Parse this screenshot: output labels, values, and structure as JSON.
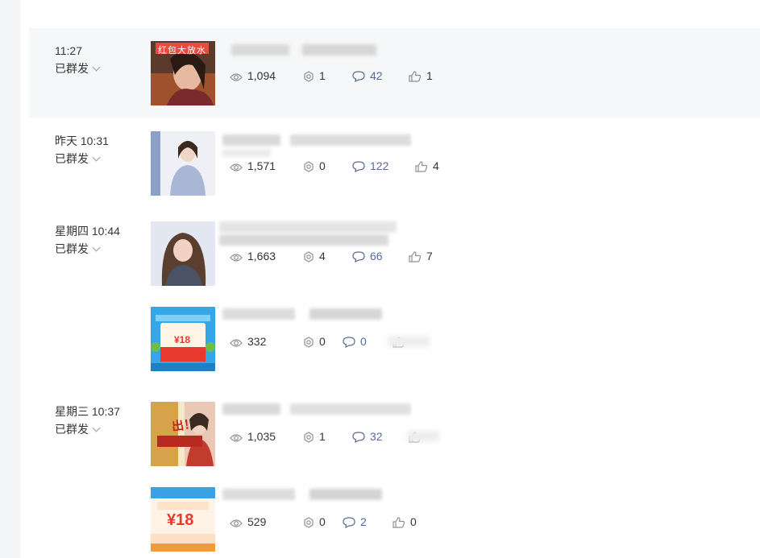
{
  "status_label": "已群发",
  "posts": [
    {
      "time": "11:27",
      "status": "已群发",
      "thumb_icon": "red-packet-woman-thumbnail",
      "thumb_text": "红包大放水",
      "stats": {
        "views": "1,094",
        "shares": "1",
        "comments": "42",
        "likes": "1"
      }
    },
    {
      "time": "昨天 10:31",
      "status": "已群发",
      "thumb_icon": "woman-portrait-thumbnail",
      "stats": {
        "views": "1,571",
        "shares": "0",
        "comments": "122",
        "likes": "4"
      }
    },
    {
      "time": "星期四 10:44",
      "status": "已群发",
      "thumb_icon": "woman-portrait-thumbnail",
      "stats": {
        "views": "1,663",
        "shares": "4",
        "comments": "66",
        "likes": "7"
      }
    },
    {
      "time": "",
      "status": "",
      "thumb_icon": "red-packet-coupon-thumbnail",
      "thumb_text": "¥18",
      "stats": {
        "views": "332",
        "shares": "0",
        "comments": "0",
        "likes": ""
      }
    },
    {
      "time": "星期三 10:37",
      "status": "已群发",
      "thumb_icon": "poster-thumbnail",
      "thumb_text": "出！",
      "stats": {
        "views": "1,035",
        "shares": "1",
        "comments": "32",
        "likes": ""
      }
    },
    {
      "time": "",
      "status": "",
      "thumb_icon": "red-packet-coupon-thumbnail",
      "thumb_text": "¥18",
      "stats": {
        "views": "529",
        "shares": "0",
        "comments": "2",
        "likes": "0"
      }
    }
  ],
  "colors": {
    "comment_number": "#576b95",
    "hover_row_bg": "#f6f7f8",
    "icon_stroke": "#8f8f8f"
  },
  "icons": {
    "views": "eye-icon",
    "shares": "share-icon",
    "comments": "comment-icon",
    "likes": "thumbs-up-icon"
  }
}
